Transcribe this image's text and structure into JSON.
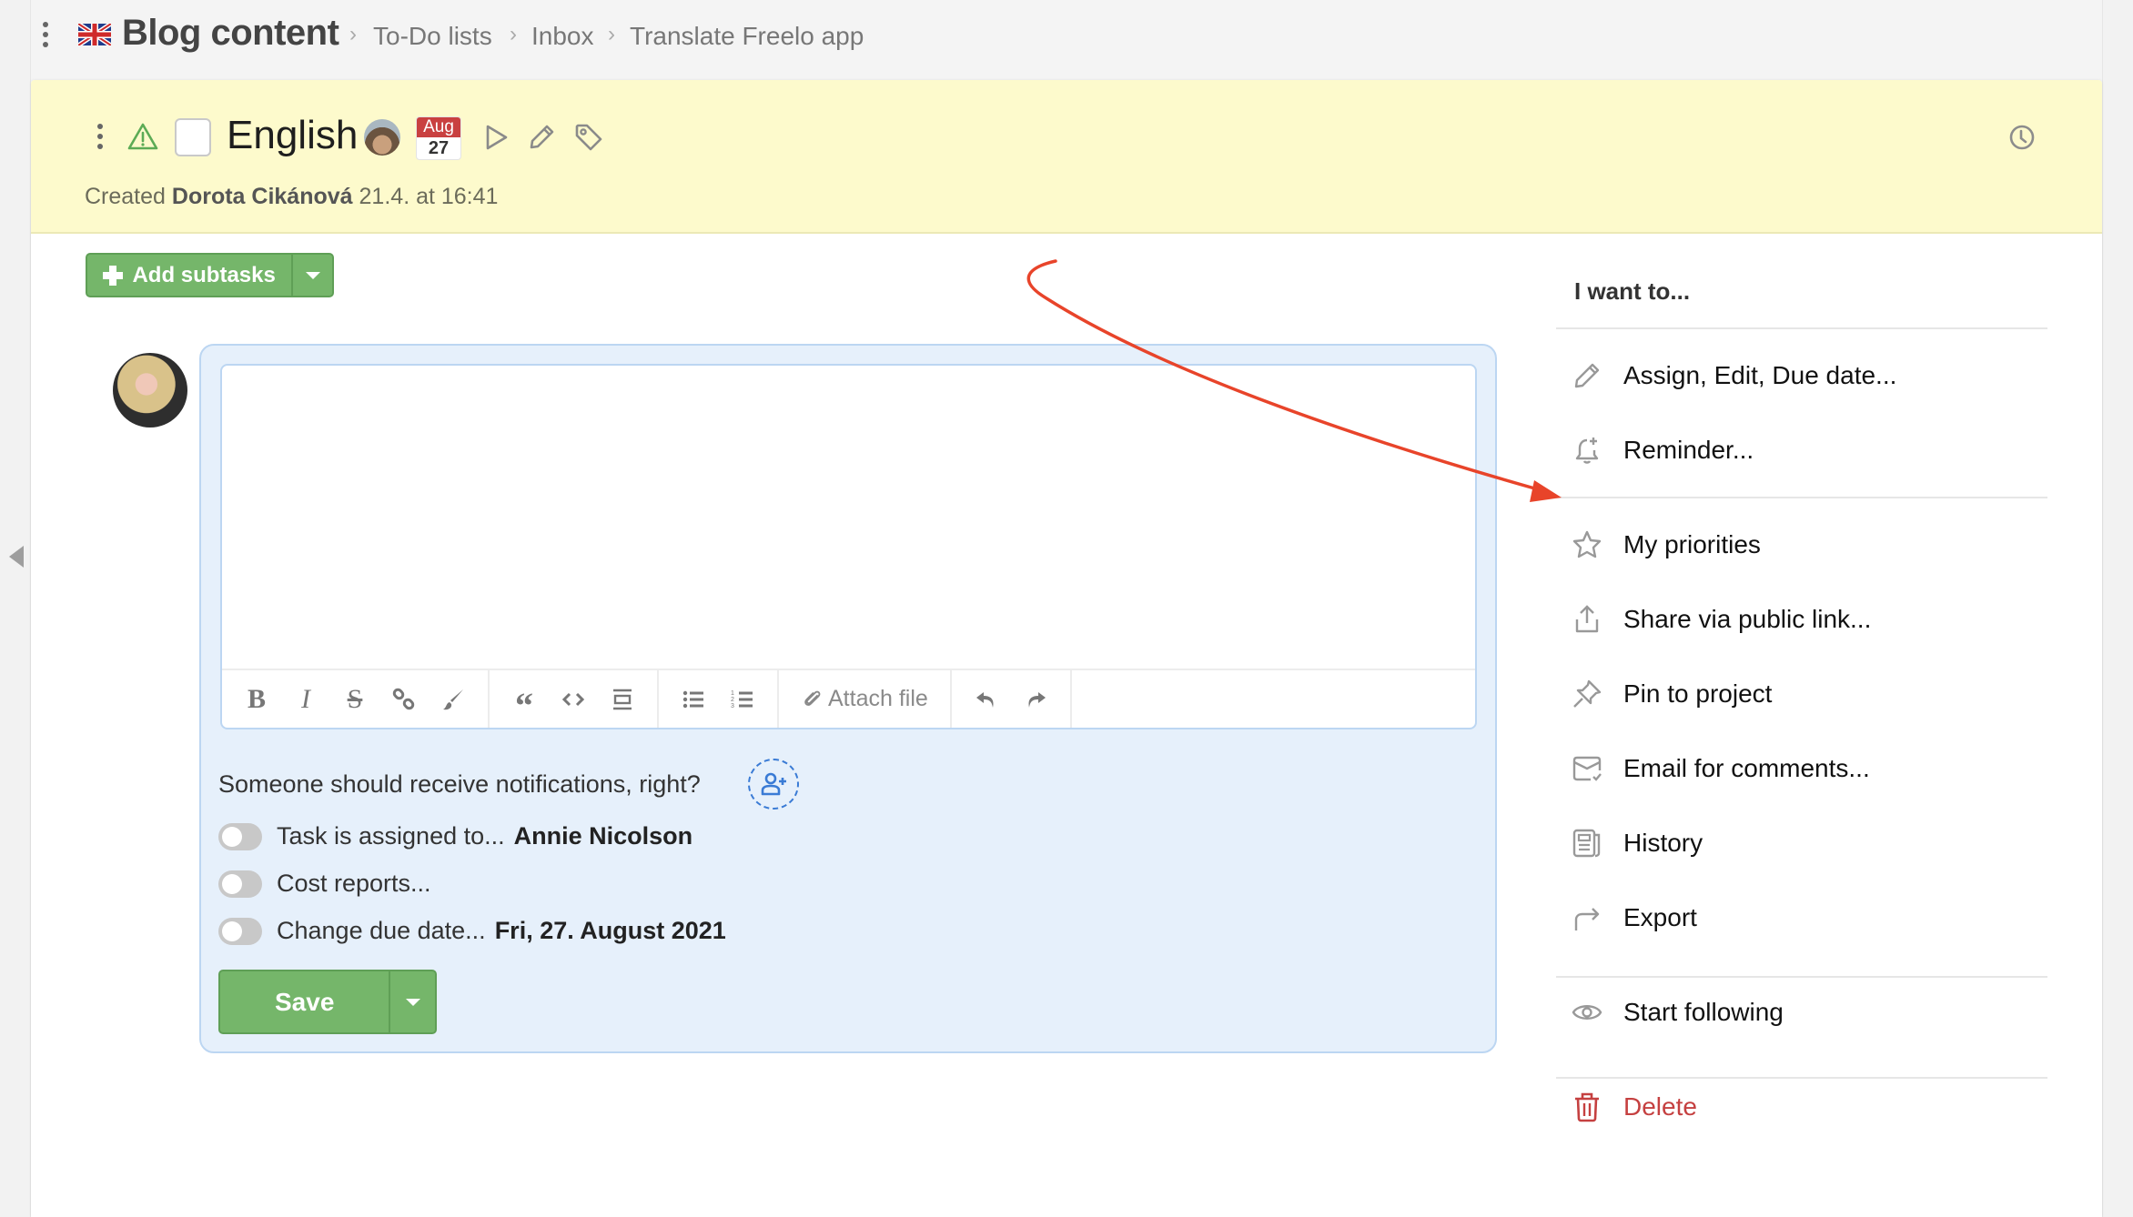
{
  "breadcrumb": {
    "project_title": "Blog content",
    "items": [
      "To-Do lists",
      "Inbox",
      "Translate Freelo app"
    ],
    "separator": "›"
  },
  "task": {
    "title": "English",
    "due_badge": {
      "month": "Aug",
      "day": "27"
    },
    "created_prefix": "Created",
    "created_by": "Dorota Cikánová",
    "created_at": "21.4. at 16:41"
  },
  "subtasks": {
    "add_label": "Add subtasks"
  },
  "editor": {
    "value": "",
    "attach_label": "Attach file",
    "toolbar_icons": [
      "bold-icon",
      "italic-icon",
      "strikethrough-icon",
      "link-icon",
      "brush-icon",
      "quote-icon",
      "code-icon",
      "horizontal-rule-icon",
      "bullet-list-icon",
      "numbered-list-icon",
      "paperclip-icon",
      "undo-icon",
      "redo-icon"
    ]
  },
  "notifications": {
    "question": "Someone should receive notifications, right?",
    "rows": [
      {
        "label": "Task is assigned to...",
        "value": "Annie Nicolson",
        "on": false
      },
      {
        "label": "Cost reports...",
        "value": "",
        "on": false
      },
      {
        "label": "Change due date...",
        "value": "Fri, 27. August 2021",
        "on": false
      }
    ]
  },
  "save": {
    "label": "Save"
  },
  "actions": {
    "title": "I want to...",
    "groups": [
      [
        {
          "label": "Assign, Edit, Due date...",
          "icon": "pencil-icon"
        },
        {
          "label": "Reminder...",
          "icon": "bell-plus-icon"
        }
      ],
      [
        {
          "label": "My priorities",
          "icon": "star-icon"
        },
        {
          "label": "Share via public link...",
          "icon": "share-icon"
        },
        {
          "label": "Pin to project",
          "icon": "pin-icon"
        },
        {
          "label": "Email for comments...",
          "icon": "email-icon"
        },
        {
          "label": "History",
          "icon": "history-icon"
        },
        {
          "label": "Export",
          "icon": "export-icon"
        }
      ],
      [
        {
          "label": "Start following",
          "icon": "eye-icon"
        }
      ],
      [
        {
          "label": "Delete",
          "icon": "trash-icon"
        }
      ]
    ]
  },
  "colors": {
    "header_bg": "#fdfacc",
    "accent_green": "#75b66a",
    "comment_panel_bg": "#e6f0fb",
    "danger": "#c54040",
    "annotation_red": "#e8442a",
    "date_badge_red": "#c94040"
  }
}
